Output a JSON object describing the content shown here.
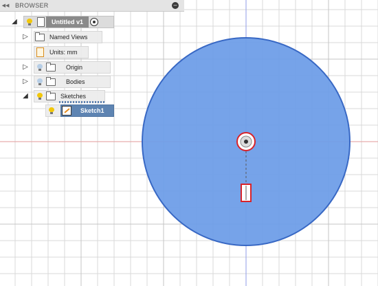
{
  "canvas": {
    "grid_color": "#d9d9d9",
    "axis_x_color": "#e39a9a",
    "axis_y_color": "#8f9be8",
    "circle_fill": "#6f9ee8",
    "circle_stroke": "#3868c4",
    "marker_color": "#d8232a"
  },
  "browser": {
    "title": "BROWSER",
    "collapse_icon": "◀◀",
    "minimize_icon": "–",
    "root": {
      "label": "Untitled v1"
    },
    "items": [
      {
        "label": "Named Views"
      },
      {
        "label": "Units: mm"
      },
      {
        "label": "Origin"
      },
      {
        "label": "Bodies"
      },
      {
        "label": "Sketches"
      },
      {
        "label": "Sketch1"
      }
    ]
  }
}
